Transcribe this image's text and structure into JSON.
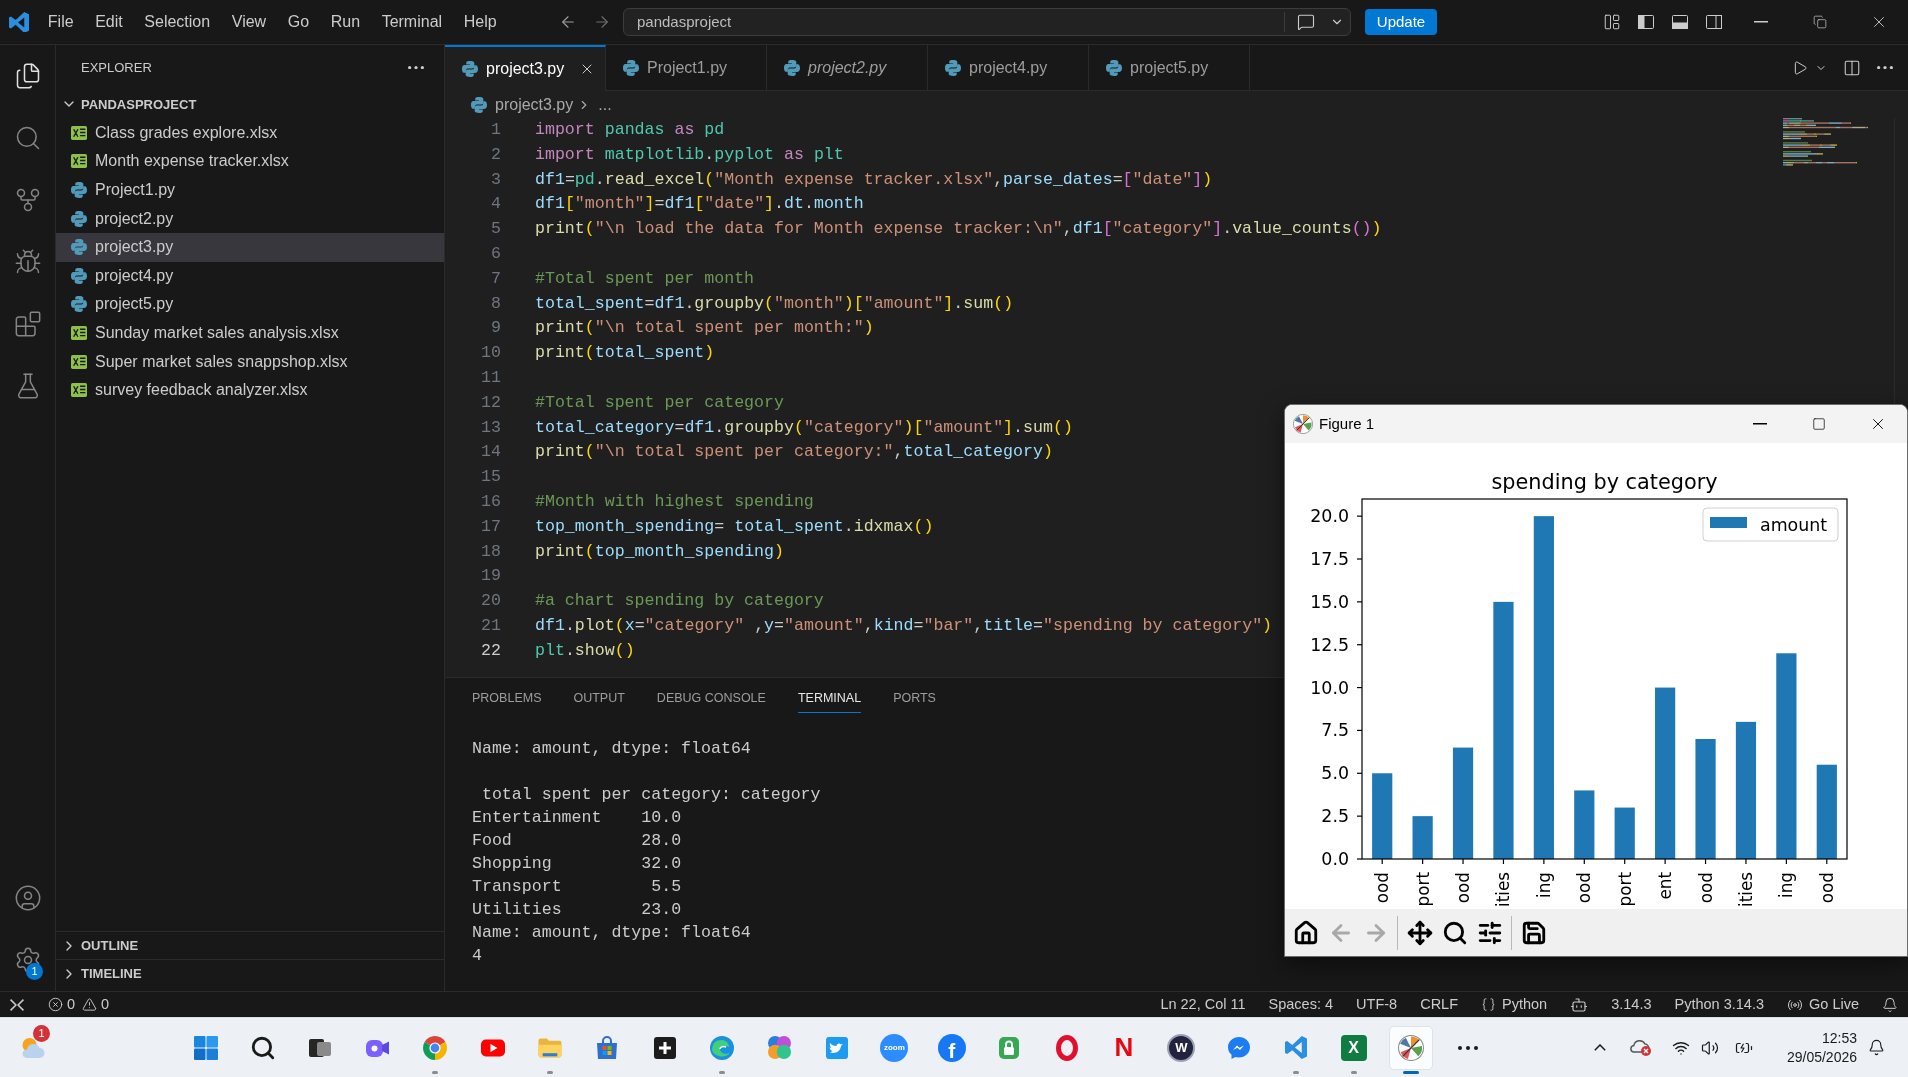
{
  "title_bar": {
    "menu": [
      "File",
      "Edit",
      "Selection",
      "View",
      "Go",
      "Run",
      "Terminal",
      "Help"
    ],
    "command_center": "pandasproject",
    "update_button": "Update",
    "layout_toggles": [
      {
        "kind": "sidebar",
        "on": true
      },
      {
        "kind": "panel",
        "on": true
      },
      {
        "kind": "secondary",
        "on": false
      }
    ]
  },
  "activity_bar": {
    "items": [
      {
        "kind": "files",
        "selected": true
      },
      {
        "kind": "search",
        "selected": false
      },
      {
        "kind": "branch",
        "selected": false
      },
      {
        "kind": "debug",
        "selected": false
      },
      {
        "kind": "extensions",
        "selected": false
      },
      {
        "kind": "testing",
        "selected": false
      }
    ],
    "settings_badge": "1"
  },
  "sidebar": {
    "title": "EXPLORER",
    "folder": {
      "name": "PANDASPROJECT",
      "expanded": true,
      "children": [
        {
          "name": "Class grades explore.xlsx",
          "kind": "spreadsheet",
          "selected": false
        },
        {
          "name": "Month expense tracker.xlsx",
          "kind": "spreadsheet",
          "selected": false
        },
        {
          "name": "Project1.py",
          "kind": "python",
          "selected": false
        },
        {
          "name": "project2.py",
          "kind": "python",
          "selected": false
        },
        {
          "name": "project3.py",
          "kind": "python",
          "selected": true
        },
        {
          "name": "project4.py",
          "kind": "python",
          "selected": false
        },
        {
          "name": "project5.py",
          "kind": "python",
          "selected": false
        },
        {
          "name": "Sunday market sales analysis.xlsx",
          "kind": "spreadsheet",
          "selected": false
        },
        {
          "name": "Super market sales snappshop.xlsx",
          "kind": "spreadsheet",
          "selected": false
        },
        {
          "name": "survey feedback analyzer.xlsx",
          "kind": "spreadsheet",
          "selected": false
        }
      ]
    },
    "sections": [
      {
        "name": "OUTLINE",
        "expanded": false
      },
      {
        "name": "TIMELINE",
        "expanded": false
      }
    ]
  },
  "tabs": [
    {
      "label": "project3.py",
      "selected": true,
      "preview": false
    },
    {
      "label": "Project1.py",
      "selected": false,
      "preview": false
    },
    {
      "label": "project2.py",
      "selected": false,
      "preview": true
    },
    {
      "label": "project4.py",
      "selected": false,
      "preview": false
    },
    {
      "label": "project5.py",
      "selected": false,
      "preview": false
    }
  ],
  "breadcrumb": {
    "file": "project3.py",
    "more": "..."
  },
  "editor": {
    "lines": [
      {
        "number": "1",
        "current": false,
        "tokens": [
          {
            "kind": "keyword",
            "text": "import "
          },
          {
            "kind": "module",
            "text": "pandas "
          },
          {
            "kind": "keyword",
            "text": "as "
          },
          {
            "kind": "module",
            "text": "pd"
          }
        ]
      },
      {
        "number": "2",
        "current": false,
        "tokens": [
          {
            "kind": "keyword",
            "text": "import "
          },
          {
            "kind": "module",
            "text": "matplotlib"
          },
          {
            "kind": "plain",
            "text": "."
          },
          {
            "kind": "module",
            "text": "pyplot "
          },
          {
            "kind": "keyword",
            "text": "as "
          },
          {
            "kind": "module",
            "text": "plt"
          }
        ]
      },
      {
        "number": "3",
        "current": false,
        "tokens": [
          {
            "kind": "variable",
            "text": "df1"
          },
          {
            "kind": "plain",
            "text": "="
          },
          {
            "kind": "module",
            "text": "pd"
          },
          {
            "kind": "plain",
            "text": "."
          },
          {
            "kind": "function",
            "text": "read_excel"
          },
          {
            "kind": "bracket1",
            "text": "("
          },
          {
            "kind": "string",
            "text": "\"Month expense tracker.xlsx\""
          },
          {
            "kind": "plain",
            "text": ","
          },
          {
            "kind": "variable",
            "text": "parse_dates"
          },
          {
            "kind": "plain",
            "text": "="
          },
          {
            "kind": "bracket2",
            "text": "["
          },
          {
            "kind": "string",
            "text": "\"date\""
          },
          {
            "kind": "bracket2",
            "text": "]"
          },
          {
            "kind": "bracket1",
            "text": ")"
          }
        ]
      },
      {
        "number": "4",
        "current": false,
        "tokens": [
          {
            "kind": "variable",
            "text": "df1"
          },
          {
            "kind": "bracket1",
            "text": "["
          },
          {
            "kind": "string",
            "text": "\"month\""
          },
          {
            "kind": "bracket1",
            "text": "]"
          },
          {
            "kind": "plain",
            "text": "="
          },
          {
            "kind": "variable",
            "text": "df1"
          },
          {
            "kind": "bracket1",
            "text": "["
          },
          {
            "kind": "string",
            "text": "\"date\""
          },
          {
            "kind": "bracket1",
            "text": "]"
          },
          {
            "kind": "plain",
            "text": "."
          },
          {
            "kind": "variable",
            "text": "dt"
          },
          {
            "kind": "plain",
            "text": "."
          },
          {
            "kind": "variable",
            "text": "month"
          }
        ]
      },
      {
        "number": "5",
        "current": false,
        "tokens": [
          {
            "kind": "function",
            "text": "print"
          },
          {
            "kind": "bracket1",
            "text": "("
          },
          {
            "kind": "string",
            "text": "\"\\n load the data for Month expense tracker:\\n\""
          },
          {
            "kind": "plain",
            "text": ","
          },
          {
            "kind": "variable",
            "text": "df1"
          },
          {
            "kind": "bracket2",
            "text": "["
          },
          {
            "kind": "string",
            "text": "\"category\""
          },
          {
            "kind": "bracket2",
            "text": "]"
          },
          {
            "kind": "plain",
            "text": "."
          },
          {
            "kind": "function",
            "text": "value_counts"
          },
          {
            "kind": "bracket2",
            "text": "()"
          },
          {
            "kind": "bracket1",
            "text": ")"
          }
        ]
      },
      {
        "number": "6",
        "current": false
      },
      {
        "number": "7",
        "current": false,
        "tokens": [
          {
            "kind": "comment",
            "text": "#Total spent per month"
          }
        ]
      },
      {
        "number": "8",
        "current": false,
        "tokens": [
          {
            "kind": "variable",
            "text": "total_spent"
          },
          {
            "kind": "plain",
            "text": "="
          },
          {
            "kind": "variable",
            "text": "df1"
          },
          {
            "kind": "plain",
            "text": "."
          },
          {
            "kind": "function",
            "text": "groupby"
          },
          {
            "kind": "bracket1",
            "text": "("
          },
          {
            "kind": "string",
            "text": "\"month\""
          },
          {
            "kind": "bracket1",
            "text": ")["
          },
          {
            "kind": "string",
            "text": "\"amount\""
          },
          {
            "kind": "bracket1",
            "text": "]"
          },
          {
            "kind": "plain",
            "text": "."
          },
          {
            "kind": "function",
            "text": "sum"
          },
          {
            "kind": "bracket1",
            "text": "()"
          }
        ]
      },
      {
        "number": "9",
        "current": false,
        "tokens": [
          {
            "kind": "function",
            "text": "print"
          },
          {
            "kind": "bracket1",
            "text": "("
          },
          {
            "kind": "string",
            "text": "\"\\n total spent per month:\""
          },
          {
            "kind": "bracket1",
            "text": ")"
          }
        ]
      },
      {
        "number": "10",
        "current": false,
        "tokens": [
          {
            "kind": "function",
            "text": "print"
          },
          {
            "kind": "bracket1",
            "text": "("
          },
          {
            "kind": "variable",
            "text": "total_spent"
          },
          {
            "kind": "bracket1",
            "text": ")"
          }
        ]
      },
      {
        "number": "11",
        "current": false
      },
      {
        "number": "12",
        "current": false,
        "tokens": [
          {
            "kind": "comment",
            "text": "#Total spent per category"
          }
        ]
      },
      {
        "number": "13",
        "current": false,
        "tokens": [
          {
            "kind": "variable",
            "text": "total_category"
          },
          {
            "kind": "plain",
            "text": "="
          },
          {
            "kind": "variable",
            "text": "df1"
          },
          {
            "kind": "plain",
            "text": "."
          },
          {
            "kind": "function",
            "text": "groupby"
          },
          {
            "kind": "bracket1",
            "text": "("
          },
          {
            "kind": "string",
            "text": "\"category\""
          },
          {
            "kind": "bracket1",
            "text": ")["
          },
          {
            "kind": "string",
            "text": "\"amount\""
          },
          {
            "kind": "bracket1",
            "text": "]"
          },
          {
            "kind": "plain",
            "text": "."
          },
          {
            "kind": "function",
            "text": "sum"
          },
          {
            "kind": "bracket1",
            "text": "()"
          }
        ]
      },
      {
        "number": "14",
        "current": false,
        "tokens": [
          {
            "kind": "function",
            "text": "print"
          },
          {
            "kind": "bracket1",
            "text": "("
          },
          {
            "kind": "string",
            "text": "\"\\n total spent per category:\""
          },
          {
            "kind": "plain",
            "text": ","
          },
          {
            "kind": "variable",
            "text": "total_category"
          },
          {
            "kind": "bracket1",
            "text": ")"
          }
        ]
      },
      {
        "number": "15",
        "current": false
      },
      {
        "number": "16",
        "current": false,
        "tokens": [
          {
            "kind": "comment",
            "text": "#Month with highest spending"
          }
        ]
      },
      {
        "number": "17",
        "current": false,
        "tokens": [
          {
            "kind": "variable",
            "text": "top_month_spending"
          },
          {
            "kind": "plain",
            "text": "= "
          },
          {
            "kind": "variable",
            "text": "total_spent"
          },
          {
            "kind": "plain",
            "text": "."
          },
          {
            "kind": "function",
            "text": "idxmax"
          },
          {
            "kind": "bracket1",
            "text": "()"
          }
        ]
      },
      {
        "number": "18",
        "current": false,
        "tokens": [
          {
            "kind": "function",
            "text": "print"
          },
          {
            "kind": "bracket1",
            "text": "("
          },
          {
            "kind": "variable",
            "text": "top_month_spending"
          },
          {
            "kind": "bracket1",
            "text": ")"
          }
        ]
      },
      {
        "number": "19",
        "current": false
      },
      {
        "number": "20",
        "current": false,
        "tokens": [
          {
            "kind": "comment",
            "text": "#a chart spending by category"
          }
        ]
      },
      {
        "number": "21",
        "current": false,
        "tokens": [
          {
            "kind": "variable",
            "text": "df1"
          },
          {
            "kind": "plain",
            "text": "."
          },
          {
            "kind": "function",
            "text": "plot"
          },
          {
            "kind": "bracket1",
            "text": "("
          },
          {
            "kind": "variable",
            "text": "x"
          },
          {
            "kind": "plain",
            "text": "="
          },
          {
            "kind": "string",
            "text": "\"category\""
          },
          {
            "kind": "plain",
            "text": " ,"
          },
          {
            "kind": "variable",
            "text": "y"
          },
          {
            "kind": "plain",
            "text": "="
          },
          {
            "kind": "string",
            "text": "\"amount\""
          },
          {
            "kind": "plain",
            "text": ","
          },
          {
            "kind": "variable",
            "text": "kind"
          },
          {
            "kind": "plain",
            "text": "="
          },
          {
            "kind": "string",
            "text": "\"bar\""
          },
          {
            "kind": "plain",
            "text": ","
          },
          {
            "kind": "variable",
            "text": "title"
          },
          {
            "kind": "plain",
            "text": "="
          },
          {
            "kind": "string",
            "text": "\"spending by category\""
          },
          {
            "kind": "bracket1",
            "text": ")"
          }
        ]
      },
      {
        "number": "22",
        "current": true,
        "tokens": [
          {
            "kind": "module",
            "text": "plt"
          },
          {
            "kind": "plain",
            "text": "."
          },
          {
            "kind": "function",
            "text": "show"
          },
          {
            "kind": "bracket1",
            "text": "()"
          }
        ]
      }
    ]
  },
  "panel": {
    "tabs": [
      {
        "label": "PROBLEMS",
        "selected": false
      },
      {
        "label": "OUTPUT",
        "selected": false
      },
      {
        "label": "DEBUG CONSOLE",
        "selected": false
      },
      {
        "label": "TERMINAL",
        "selected": true
      },
      {
        "label": "PORTS",
        "selected": false
      }
    ],
    "terminal_blocks": [
      [
        "Name: amount, dtype: float64"
      ],
      [
        " total spent per category: category",
        "Entertainment    10.0",
        "Food             28.0",
        "Shopping         32.0",
        "Transport         5.5",
        "Utilities        23.0",
        "Name: amount, dtype: float64",
        "4"
      ]
    ]
  },
  "figure_window": {
    "title": "Figure 1",
    "chart_data": {
      "type": "bar",
      "title": "spending by category",
      "categories": [
        "ood",
        "port",
        "ood",
        "ities",
        "ing",
        "ood",
        "port",
        "ent",
        "ood",
        "ities",
        "ing",
        "ood"
      ],
      "series": [
        {
          "name": "amount",
          "color": "#1f77b4",
          "values": [
            5,
            2.5,
            6.5,
            15,
            20,
            4,
            3,
            10,
            7,
            8,
            12,
            5.5
          ]
        }
      ],
      "ylim": [
        0,
        21
      ],
      "yticks": [
        {
          "value": 0,
          "label": "0.0"
        },
        {
          "value": 2.5,
          "label": "2.5"
        },
        {
          "value": 5,
          "label": "5.0"
        },
        {
          "value": 7.5,
          "label": "7.5"
        },
        {
          "value": 10,
          "label": "10.0"
        },
        {
          "value": 12.5,
          "label": "12.5"
        },
        {
          "value": 15,
          "label": "15.0"
        },
        {
          "value": 17.5,
          "label": "17.5"
        },
        {
          "value": 20,
          "label": "20.0"
        }
      ]
    },
    "toolbar": [
      [
        {
          "kind": "home",
          "disabled": false
        },
        {
          "kind": "back",
          "disabled": true
        },
        {
          "kind": "forward",
          "disabled": true
        }
      ],
      [
        {
          "kind": "pan",
          "disabled": false
        },
        {
          "kind": "zoom",
          "disabled": false
        },
        {
          "kind": "configure",
          "disabled": false
        }
      ],
      [
        {
          "kind": "save",
          "disabled": false
        }
      ]
    ]
  },
  "status_bar": {
    "errors": "0",
    "warnings": "0",
    "position": "Ln 22, Col 11",
    "indentation": "Spaces: 4",
    "encoding": "UTF-8",
    "line_ending": "CRLF",
    "language": "Python",
    "version": "3.14.3",
    "interpreter": "Python 3.14.3",
    "live_server": "Go Live"
  },
  "taskbar": {
    "weather_badge": "1",
    "apps": [
      {
        "kind": "start",
        "running": false,
        "selected": false
      },
      {
        "kind": "search",
        "running": false,
        "selected": false
      },
      {
        "kind": "taskview",
        "running": false,
        "selected": false
      },
      {
        "kind": "camera",
        "running": false,
        "selected": false
      },
      {
        "kind": "wheel",
        "running": true,
        "selected": false
      },
      {
        "kind": "player",
        "running": false,
        "selected": false
      },
      {
        "kind": "folder",
        "running": true,
        "selected": false
      },
      {
        "kind": "store",
        "running": false,
        "selected": false
      },
      {
        "kind": "plustile",
        "running": false,
        "selected": false
      },
      {
        "kind": "swirl",
        "running": true,
        "selected": false
      },
      {
        "kind": "petals",
        "running": false,
        "selected": false
      },
      {
        "kind": "bird",
        "running": false,
        "selected": false
      },
      {
        "kind": "meeting",
        "glyph": "zoom",
        "running": false,
        "selected": false
      },
      {
        "kind": "social",
        "glyph": "f",
        "running": false,
        "selected": false
      },
      {
        "kind": "lock",
        "running": false,
        "selected": false
      },
      {
        "kind": "ring",
        "running": false,
        "selected": false
      },
      {
        "kind": "streaming",
        "glyph": "N",
        "running": false,
        "selected": false
      },
      {
        "kind": "wcircle",
        "glyph": "W",
        "running": false,
        "selected": false
      },
      {
        "kind": "messenger",
        "running": false,
        "selected": false
      },
      {
        "kind": "editor",
        "running": true,
        "selected": false
      },
      {
        "kind": "spreadsheet",
        "glyph": "X",
        "running": true,
        "selected": false
      },
      {
        "kind": "figure",
        "running": true,
        "selected": true
      },
      {
        "kind": "overflow",
        "running": false,
        "selected": false
      }
    ],
    "clock": {
      "time": "12:53",
      "date": "29/05/2026"
    }
  }
}
